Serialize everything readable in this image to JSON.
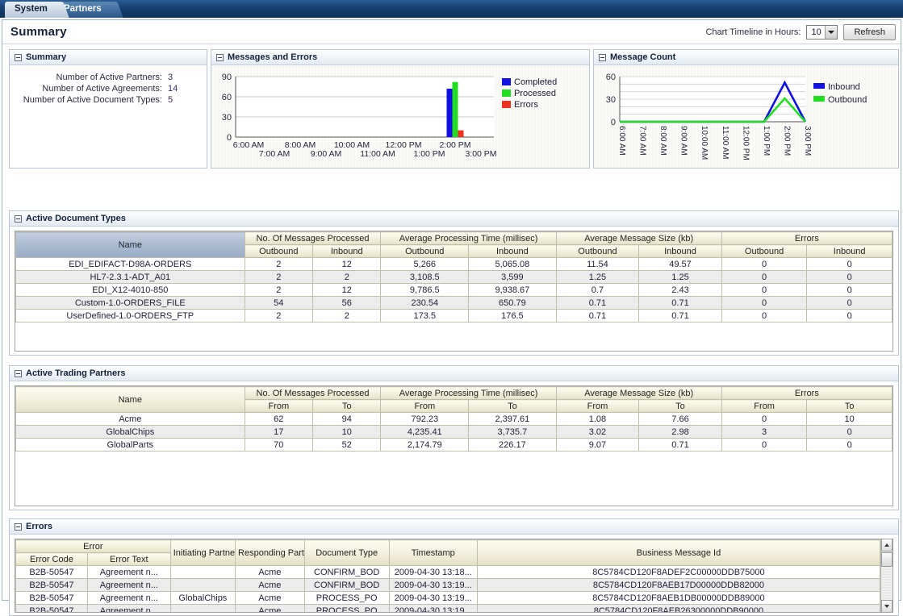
{
  "tabs": [
    {
      "label": "System",
      "active": true
    },
    {
      "label": "Partners",
      "active": false
    }
  ],
  "header": {
    "title": "Summary",
    "timeline_label": "Chart Timeline in Hours:",
    "timeline_value": "10",
    "refresh_label": "Refresh"
  },
  "summary_panel": {
    "title": "Summary",
    "rows": [
      {
        "label": "Number of Active Partners:",
        "value": "3"
      },
      {
        "label": "Number of Active Agreements:",
        "value": "14"
      },
      {
        "label": "Number of Active Document Types:",
        "value": "5"
      }
    ]
  },
  "messages_errors_panel": {
    "title": "Messages and Errors"
  },
  "message_count_panel": {
    "title": "Message Count"
  },
  "chart_data": [
    {
      "type": "bar",
      "title": "Messages and Errors",
      "xlabel": "",
      "ylabel": "",
      "ylim": [
        0,
        90
      ],
      "yticks": [
        0,
        30,
        60,
        90
      ],
      "grid": true,
      "legend_position": "right",
      "categories": [
        "6:00 AM",
        "7:00 AM",
        "8:00 AM",
        "9:00 AM",
        "10:00 AM",
        "11:00 AM",
        "12:00 PM",
        "1:00 PM",
        "2:00 PM",
        "3:00 PM"
      ],
      "series": [
        {
          "name": "Completed",
          "color": "#1010e0",
          "values": [
            0,
            0,
            0,
            0,
            0,
            0,
            0,
            0,
            72,
            0
          ]
        },
        {
          "name": "Processed",
          "color": "#22dd22",
          "values": [
            0,
            0,
            0,
            0,
            0,
            0,
            0,
            0,
            82,
            0
          ]
        },
        {
          "name": "Errors",
          "color": "#ee3322",
          "values": [
            0,
            0,
            0,
            0,
            0,
            0,
            0,
            0,
            10,
            0
          ]
        }
      ]
    },
    {
      "type": "line",
      "title": "Message Count",
      "xlabel": "",
      "ylabel": "",
      "ylim": [
        0,
        60
      ],
      "yticks": [
        0,
        30,
        60
      ],
      "grid": true,
      "legend_position": "right",
      "categories": [
        "6:00 AM",
        "7:00 AM",
        "8:00 AM",
        "9:00 AM",
        "10:00 AM",
        "11:00 AM",
        "12:00 PM",
        "1:00 PM",
        "2:00 PM",
        "3:00 PM"
      ],
      "series": [
        {
          "name": "Inbound",
          "color": "#1010e0",
          "values": [
            0,
            0,
            0,
            0,
            0,
            0,
            0,
            0,
            52,
            0
          ]
        },
        {
          "name": "Outbound",
          "color": "#22dd22",
          "values": [
            0,
            0,
            0,
            0,
            0,
            0,
            0,
            0,
            31,
            0
          ]
        }
      ]
    }
  ],
  "doctypes_panel": {
    "title": "Active Document Types",
    "group_headers": [
      {
        "label": "Name",
        "span": 1,
        "rowspan": 2,
        "sorted": true
      },
      {
        "label": "No. Of Messages Processed",
        "span": 2
      },
      {
        "label": "Average Processing Time (millisec)",
        "span": 2
      },
      {
        "label": "Average Message Size (kb)",
        "span": 2
      },
      {
        "label": "Errors",
        "span": 2
      }
    ],
    "sub_headers": [
      "Outbound",
      "Inbound",
      "Outbound",
      "Inbound",
      "Outbound",
      "Inbound",
      "Outbound",
      "Inbound"
    ],
    "rows": [
      {
        "name": "EDI_EDIFACT-D98A-ORDERS",
        "cells": [
          "2",
          "12",
          "5,266",
          "5,065.08",
          "11.54",
          "49.57",
          "0",
          "0"
        ]
      },
      {
        "name": "HL7-2.3.1-ADT_A01",
        "cells": [
          "2",
          "2",
          "3,108.5",
          "3,599",
          "1.25",
          "1.25",
          "0",
          "0"
        ]
      },
      {
        "name": "EDI_X12-4010-850",
        "cells": [
          "2",
          "12",
          "9,786.5",
          "9,938.67",
          "0.7",
          "2.43",
          "0",
          "0"
        ]
      },
      {
        "name": "Custom-1.0-ORDERS_FILE",
        "cells": [
          "54",
          "56",
          "230.54",
          "650.79",
          "0.71",
          "0.71",
          "0",
          "0"
        ]
      },
      {
        "name": "UserDefined-1.0-ORDERS_FTP",
        "cells": [
          "2",
          "2",
          "173.5",
          "176.5",
          "0.71",
          "0.71",
          "0",
          "0"
        ]
      }
    ]
  },
  "partners_panel": {
    "title": "Active Trading Partners",
    "group_headers": [
      {
        "label": "Name",
        "span": 1,
        "rowspan": 2,
        "sorted": false
      },
      {
        "label": "No. Of Messages Processed",
        "span": 2
      },
      {
        "label": "Average Processing Time (millisec)",
        "span": 2
      },
      {
        "label": "Average Message Size (kb)",
        "span": 2
      },
      {
        "label": "Errors",
        "span": 2
      }
    ],
    "sub_headers": [
      "From",
      "To",
      "From",
      "To",
      "From",
      "To",
      "From",
      "To"
    ],
    "rows": [
      {
        "name": "Acme",
        "cells": [
          "62",
          "94",
          "792.23",
          "2,397.61",
          "1.08",
          "7.66",
          "0",
          "10"
        ]
      },
      {
        "name": "GlobalChips",
        "cells": [
          "17",
          "10",
          "4,235.41",
          "3,735.7",
          "3.02",
          "2.98",
          "3",
          "0"
        ]
      },
      {
        "name": "GlobalParts",
        "cells": [
          "70",
          "52",
          "2,174.79",
          "226.17",
          "9.07",
          "0.71",
          "0",
          "0"
        ]
      }
    ]
  },
  "errors_panel": {
    "title": "Errors",
    "group_headers": [
      {
        "label": "Error",
        "span": 2
      },
      {
        "label": "Initiating Partner",
        "span": 1,
        "rowspan": 2
      },
      {
        "label": "Responding Partner",
        "span": 1,
        "rowspan": 2
      },
      {
        "label": "Document Type",
        "span": 1,
        "rowspan": 2
      },
      {
        "label": "Timestamp",
        "span": 1,
        "rowspan": 2
      },
      {
        "label": "Business Message Id",
        "span": 1,
        "rowspan": 2
      }
    ],
    "sub_headers": [
      "Error Code",
      "Error Text"
    ],
    "rows": [
      {
        "error_code": "B2B-50547",
        "error_text": "Agreement n...",
        "initiating_partner": "",
        "responding_partner": "Acme",
        "document_type": "CONFIRM_BOD",
        "timestamp": "2009-04-30 13:18...",
        "business_message_id": "8C5784CD120F8ADEF2C00000DDB75000"
      },
      {
        "error_code": "B2B-50547",
        "error_text": "Agreement n...",
        "initiating_partner": "",
        "responding_partner": "Acme",
        "document_type": "CONFIRM_BOD",
        "timestamp": "2009-04-30 13:19...",
        "business_message_id": "8C5784CD120F8AEB17D00000DDB82000"
      },
      {
        "error_code": "B2B-50547",
        "error_text": "Agreement n...",
        "initiating_partner": "GlobalChips",
        "responding_partner": "Acme",
        "document_type": "PROCESS_PO",
        "timestamp": "2009-04-30 13:19...",
        "business_message_id": "8C5784CD120F8AEB1DB00000DDB89000"
      },
      {
        "error_code": "B2B-50547",
        "error_text": "Agreement n...",
        "initiating_partner": "",
        "responding_partner": "Acme",
        "document_type": "PROCESS_PO",
        "timestamp": "2009-04-30 13:19...",
        "business_message_id": "8C5784CD120F8AEB26300000DDB90000"
      }
    ]
  },
  "colors": {
    "error_red": "#cc0000",
    "message_id_purple": "#7b2a8f",
    "series_blue": "#1010e0",
    "series_green": "#22dd22",
    "series_red": "#ee3322",
    "tab_active_bg": "#cdd9e6",
    "tab_bar_bg": "#16406e"
  }
}
